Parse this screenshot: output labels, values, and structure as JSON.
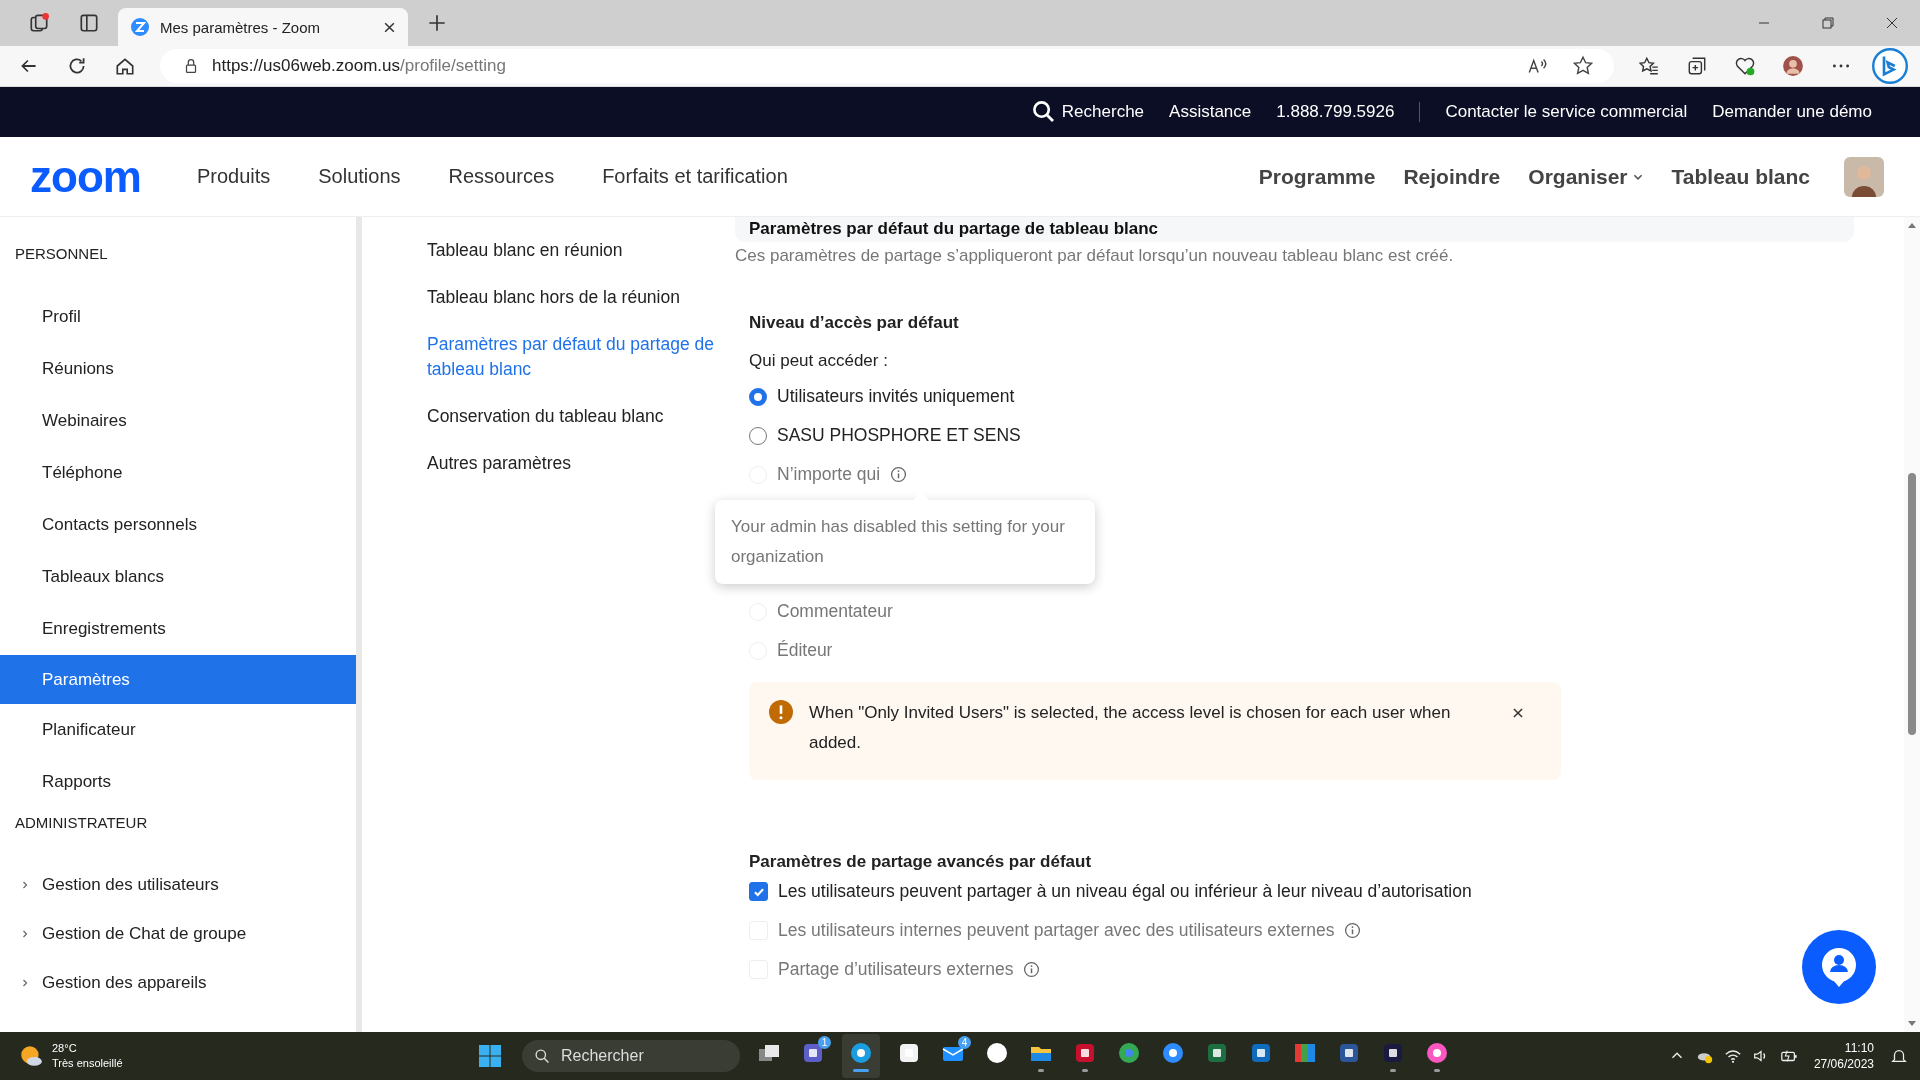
{
  "browser": {
    "tab_title": "Mes paramètres - Zoom",
    "url": {
      "host": "https://us06web.zoom.us",
      "path": "/profile/setting"
    }
  },
  "top_bar": {
    "search": "Recherche",
    "links": [
      {
        "label": "Assistance",
        "divider_after": false
      },
      {
        "label": "1.888.799.5926",
        "divider_after": true
      },
      {
        "label": "Contacter le service commercial",
        "divider_after": false
      },
      {
        "label": "Demander une démo",
        "divider_after": false
      }
    ]
  },
  "nav": {
    "logo": "zoom",
    "left": [
      {
        "label": "Produits"
      },
      {
        "label": "Solutions"
      },
      {
        "label": "Ressources"
      },
      {
        "label": "Forfaits et tarification"
      }
    ],
    "right": [
      {
        "label": "Programme",
        "dropdown": false
      },
      {
        "label": "Rejoindre",
        "dropdown": false
      },
      {
        "label": "Organiser",
        "dropdown": true
      },
      {
        "label": "Tableau blanc",
        "dropdown": false
      }
    ]
  },
  "sidebar": {
    "sections": [
      {
        "title": "PERSONNEL",
        "items": [
          {
            "label": "Profil",
            "selected": false,
            "expandable": false
          },
          {
            "label": "Réunions",
            "selected": false,
            "expandable": false
          },
          {
            "label": "Webinaires",
            "selected": false,
            "expandable": false
          },
          {
            "label": "Téléphone",
            "selected": false,
            "expandable": false
          },
          {
            "label": "Contacts personnels",
            "selected": false,
            "expandable": false
          },
          {
            "label": "Tableaux blancs",
            "selected": false,
            "expandable": false
          },
          {
            "label": "Enregistrements",
            "selected": false,
            "expandable": false
          },
          {
            "label": "Paramètres",
            "selected": true,
            "expandable": false
          },
          {
            "label": "Planificateur",
            "selected": false,
            "expandable": false
          },
          {
            "label": "Rapports",
            "selected": false,
            "expandable": false
          }
        ]
      },
      {
        "title": "ADMINISTRATEUR",
        "items": [
          {
            "label": "Gestion des utilisateurs",
            "selected": false,
            "expandable": true
          },
          {
            "label": "Gestion de Chat de groupe",
            "selected": false,
            "expandable": true
          },
          {
            "label": "Gestion des appareils",
            "selected": false,
            "expandable": true
          }
        ]
      }
    ]
  },
  "subnav": [
    {
      "label": "Tableau blanc en réunion",
      "selected": false
    },
    {
      "label": "Tableau blanc hors de la réunion",
      "selected": false
    },
    {
      "label": "Paramètres par défaut du partage de tableau blanc",
      "selected": true
    },
    {
      "label": "Conservation du tableau blanc",
      "selected": false
    },
    {
      "label": "Autres paramètres",
      "selected": false
    }
  ],
  "content": {
    "section_title": "Paramètres par défaut du partage de tableau blanc",
    "description": "Ces paramètres de partage s’appliqueront par défaut lorsqu’un nouveau tableau blanc est créé.",
    "access": {
      "title": "Niveau d’accès par défaut",
      "question": "Qui peut accéder :",
      "options": [
        {
          "label": "Utilisateurs invités uniquement",
          "selected": true,
          "disabled": false,
          "info": false
        },
        {
          "label": "SASU PHOSPHORE ET SENS",
          "selected": false,
          "disabled": false,
          "info": false
        },
        {
          "label": "N’importe qui",
          "selected": false,
          "disabled": true,
          "info": true
        }
      ],
      "tooltip": "Your admin has disabled this setting for your organization",
      "levels": [
        {
          "label": "Commentateur",
          "selected": false,
          "disabled": true
        },
        {
          "label": "Éditeur",
          "selected": false,
          "disabled": true
        }
      ]
    },
    "alert": {
      "text": "When \"Only Invited Users\" is selected, the access level is chosen for each user when added."
    },
    "advanced": {
      "title": "Paramètres de partage avancés par défaut",
      "options": [
        {
          "label": "Les utilisateurs peuvent partager à un niveau égal ou inférieur à leur niveau d’autorisation",
          "checked": true,
          "disabled": false,
          "info": false
        },
        {
          "label": "Les utilisateurs internes peuvent partager avec des utilisateurs externes",
          "checked": false,
          "disabled": true,
          "info": true
        },
        {
          "label": "Partage d’utilisateurs externes",
          "checked": false,
          "disabled": true,
          "info": true
        }
      ]
    }
  },
  "taskbar": {
    "weather": {
      "temperature": "28°C",
      "condition": "Très ensoleillé"
    },
    "search": {
      "placeholder": "Rechercher"
    },
    "apps": [
      {
        "kind": "taskview",
        "running": false,
        "active": false
      },
      {
        "kind": "teams",
        "badge": "1",
        "running": false,
        "active": false
      },
      {
        "kind": "edge",
        "running": true,
        "active": true
      },
      {
        "kind": "store",
        "running": false,
        "active": false
      },
      {
        "kind": "mail",
        "badge": "4",
        "running": false,
        "active": false
      },
      {
        "kind": "slack",
        "running": false,
        "active": false
      },
      {
        "kind": "explorer",
        "running": true,
        "active": false
      },
      {
        "kind": "acrobat",
        "running": true,
        "active": false
      },
      {
        "kind": "chrome",
        "running": false,
        "active": false
      },
      {
        "kind": "zoom",
        "running": false,
        "active": false
      },
      {
        "kind": "excel",
        "running": false,
        "active": false
      },
      {
        "kind": "outlook",
        "running": false,
        "active": false
      },
      {
        "kind": "spectrum",
        "running": false,
        "active": false
      },
      {
        "kind": "word",
        "running": false,
        "active": false
      },
      {
        "kind": "webex",
        "running": true,
        "active": false
      },
      {
        "kind": "music",
        "running": true,
        "active": false
      }
    ],
    "time": "11:10",
    "date": "27/06/2023"
  }
}
